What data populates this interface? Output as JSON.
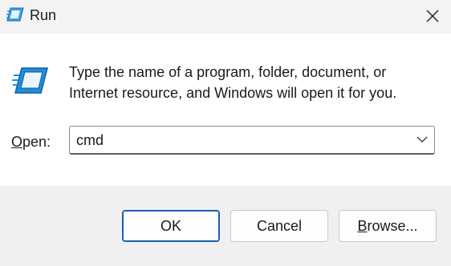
{
  "window": {
    "title": "Run",
    "icon": "run-app-icon",
    "close_icon": "close-icon"
  },
  "content": {
    "description_line1": "Type the name of a program, folder, document, or",
    "description_line2": "Internet resource, and Windows will open it for you.",
    "open_label_accel": "O",
    "open_label_rest": "pen:",
    "open_value": "cmd"
  },
  "buttons": {
    "ok": "OK",
    "cancel": "Cancel",
    "browse_accel": "B",
    "browse_rest": "rowse..."
  },
  "colors": {
    "accent": "#1a5fb4",
    "icon_blue": "#1e8fd8",
    "footer_bg": "#f0f0f0",
    "titlebar_bg": "#f3f3f3"
  }
}
